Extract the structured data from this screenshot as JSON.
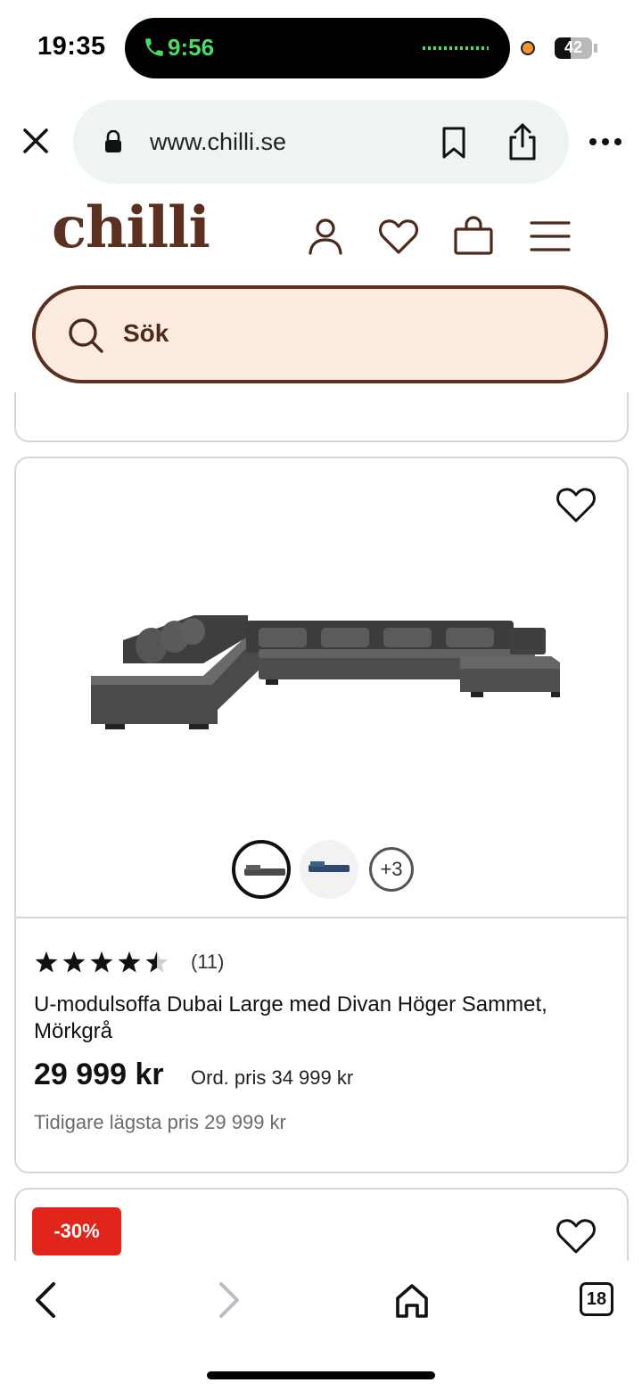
{
  "status": {
    "time": "19:35",
    "call_time": "9:56",
    "battery": "42",
    "battery_level": 0.42
  },
  "browser": {
    "url": "www.chilli.se",
    "tab_count": "18"
  },
  "site": {
    "logo": "chilli",
    "search_placeholder": "Sök"
  },
  "product": {
    "rating_count": "(11)",
    "rating": 4.5,
    "name": "U-modulsoffa Dubai Large med Divan Höger Sammet, Mörkgrå",
    "price": "29 999 kr",
    "ordinary_price": "Ord. pris 34 999 kr",
    "lowest_price": "Tidigare lägsta pris 29 999 kr",
    "more_colors": "+3"
  },
  "next_product": {
    "discount_badge": "-30%"
  },
  "colors": {
    "brand_brown": "#5b3020",
    "search_bg": "#fdebdf",
    "discount_red": "#e1251b",
    "call_green": "#4cd964"
  },
  "icons": [
    "phone-icon",
    "lock-icon",
    "close-icon",
    "bookmark-icon",
    "share-icon",
    "more-icon",
    "user-icon",
    "heart-icon",
    "bag-icon",
    "menu-icon",
    "search-icon",
    "back-icon",
    "forward-icon",
    "home-icon"
  ]
}
